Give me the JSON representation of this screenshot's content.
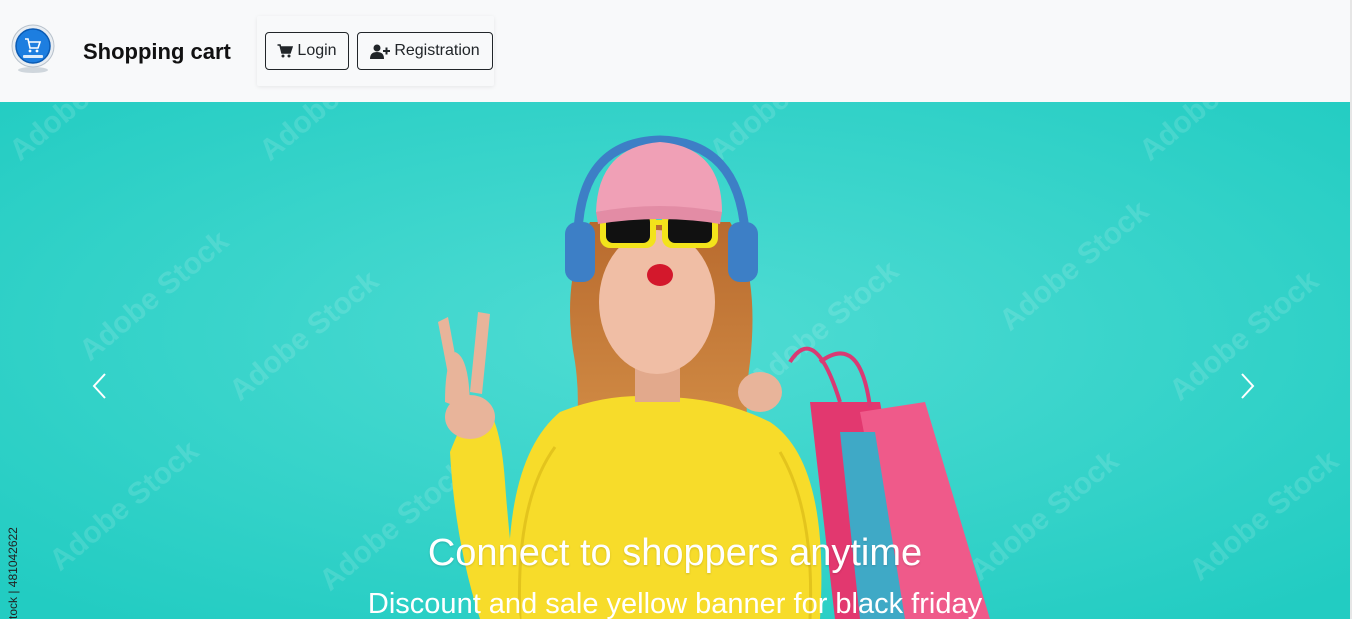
{
  "header": {
    "brand": "Shopping cart",
    "logo_icon": "cart-badge-logo",
    "login_label": "Login",
    "login_icon": "cart-icon",
    "register_label": "Registration",
    "register_icon": "user-plus-icon"
  },
  "carousel": {
    "title": "Connect to shoppers anytime",
    "subtitle": "Discount and sale yellow banner for black friday",
    "stock_id": "tock | 481042622",
    "watermark_text": "Adobe Stock",
    "prev_icon": "chevron-left-icon",
    "next_icon": "chevron-right-icon"
  },
  "colors": {
    "navbar_bg": "#f8f9fa",
    "hero_bg": "#2ad3c9",
    "sweater": "#f7dc2a",
    "hat": "#f0a0b6",
    "bags": "#e8407a"
  }
}
